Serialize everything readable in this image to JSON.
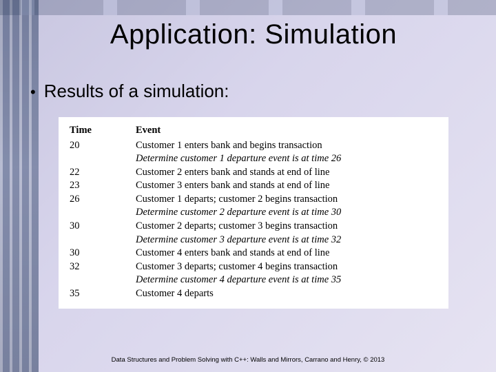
{
  "title": "Application: Simulation",
  "bullet": "Results of a simulation:",
  "table": {
    "headers": {
      "time": "Time",
      "event": "Event"
    },
    "rows": [
      {
        "time": "20",
        "event": "Customer 1 enters bank and begins transaction",
        "italic": false
      },
      {
        "time": "",
        "event": "Determine customer 1 departure event is at time 26",
        "italic": true
      },
      {
        "time": "22",
        "event": "Customer 2 enters bank and stands at end of line",
        "italic": false
      },
      {
        "time": "23",
        "event": "Customer 3 enters bank and stands at end of line",
        "italic": false
      },
      {
        "time": "26",
        "event": "Customer 1 departs; customer 2 begins transaction",
        "italic": false
      },
      {
        "time": "",
        "event": "Determine customer 2 departure event is at time 30",
        "italic": true
      },
      {
        "time": "30",
        "event": "Customer 2 departs; customer 3 begins transaction",
        "italic": false
      },
      {
        "time": "",
        "event": "Determine customer 3 departure event is at time 32",
        "italic": true
      },
      {
        "time": "30",
        "event": "Customer 4 enters bank and stands at end of line",
        "italic": false
      },
      {
        "time": "32",
        "event": "Customer 3 departs; customer 4 begins transaction",
        "italic": false
      },
      {
        "time": "",
        "event": "Determine customer 4 departure event is at time 35",
        "italic": true
      },
      {
        "time": "35",
        "event": "Customer 4 departs",
        "italic": false
      }
    ]
  },
  "footer": "Data Structures and Problem Solving with C++: Walls and Mirrors, Carrano and Henry, © 2013"
}
